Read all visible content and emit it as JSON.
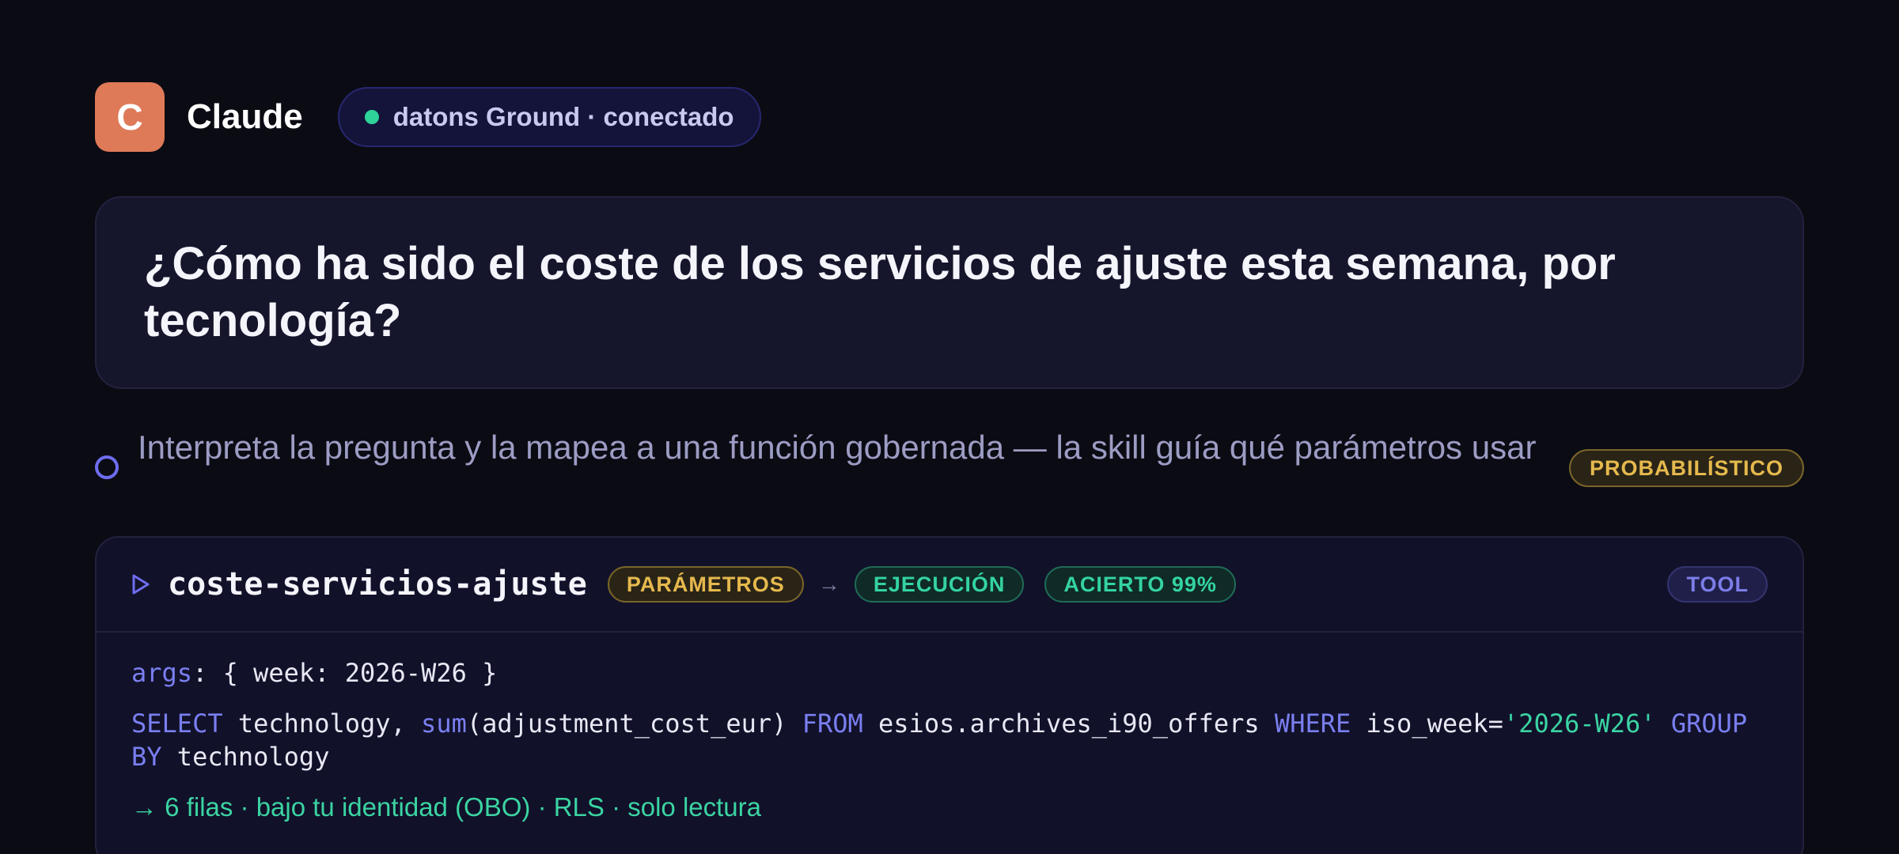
{
  "header": {
    "avatar_letter": "C",
    "brand": "Claude",
    "status": "datons Ground · conectado"
  },
  "question": {
    "text": "¿Cómo ha sido el coste de los servicios de ajuste esta semana, por tecnología?"
  },
  "step": {
    "text": "Interpreta la pregunta y la mapea a una función gobernada — la skill guía qué parámetros usar",
    "badge": "PROBABILÍSTICO"
  },
  "tool": {
    "name": "coste-servicios-ajuste",
    "chips": {
      "params": "PARÁMETROS",
      "arrow": "→",
      "exec": "EJECUCIÓN",
      "accuracy": "ACIERTO 99%",
      "type": "TOOL"
    },
    "args": {
      "keyword": "args",
      "rest": ": { week: 2026-W26 }"
    },
    "sql": {
      "select": "SELECT",
      "col1": " technology, ",
      "fn": "sum",
      "col2": "(adjustment_cost_eur) ",
      "from": "FROM",
      "table": " esios.archives_i90_offers ",
      "where": "WHERE",
      "cond": " iso_week=",
      "value": "'2026-W26'",
      "group": " GROUP BY",
      "col3": " technology"
    },
    "result": "→ 6 filas · bajo tu identidad (OBO) · RLS · solo lectura"
  },
  "colors": {
    "accent": "#6d6df0",
    "success": "#34d3a0",
    "warning": "#e5b94d",
    "avatar": "#de7a58"
  }
}
